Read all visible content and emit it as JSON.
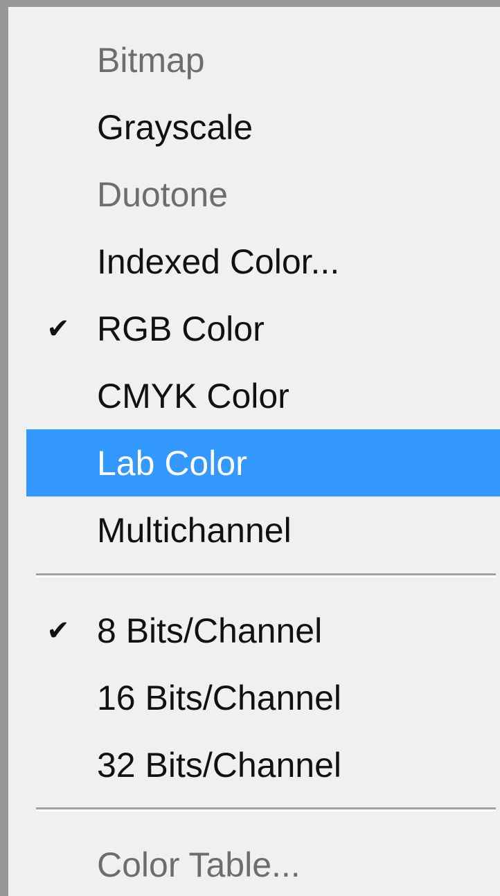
{
  "menu": {
    "group1": [
      {
        "label": "Bitmap",
        "state": "disabled"
      },
      {
        "label": "Grayscale",
        "state": "enabled"
      },
      {
        "label": "Duotone",
        "state": "disabled"
      },
      {
        "label": "Indexed Color...",
        "state": "enabled"
      },
      {
        "label": "RGB Color",
        "state": "checked"
      },
      {
        "label": "CMYK Color",
        "state": "enabled"
      },
      {
        "label": "Lab Color",
        "state": "highlighted"
      },
      {
        "label": "Multichannel",
        "state": "enabled"
      }
    ],
    "group2": [
      {
        "label": "8 Bits/Channel",
        "state": "checked"
      },
      {
        "label": "16 Bits/Channel",
        "state": "enabled"
      },
      {
        "label": "32 Bits/Channel",
        "state": "enabled"
      }
    ],
    "group3": [
      {
        "label": "Color Table...",
        "state": "disabled"
      }
    ],
    "check_glyph": "✔"
  },
  "colors": {
    "highlight": "#3399ff",
    "menu_background": "#f0f0f0",
    "disabled_text": "#6d6d6d",
    "text": "#111111"
  }
}
